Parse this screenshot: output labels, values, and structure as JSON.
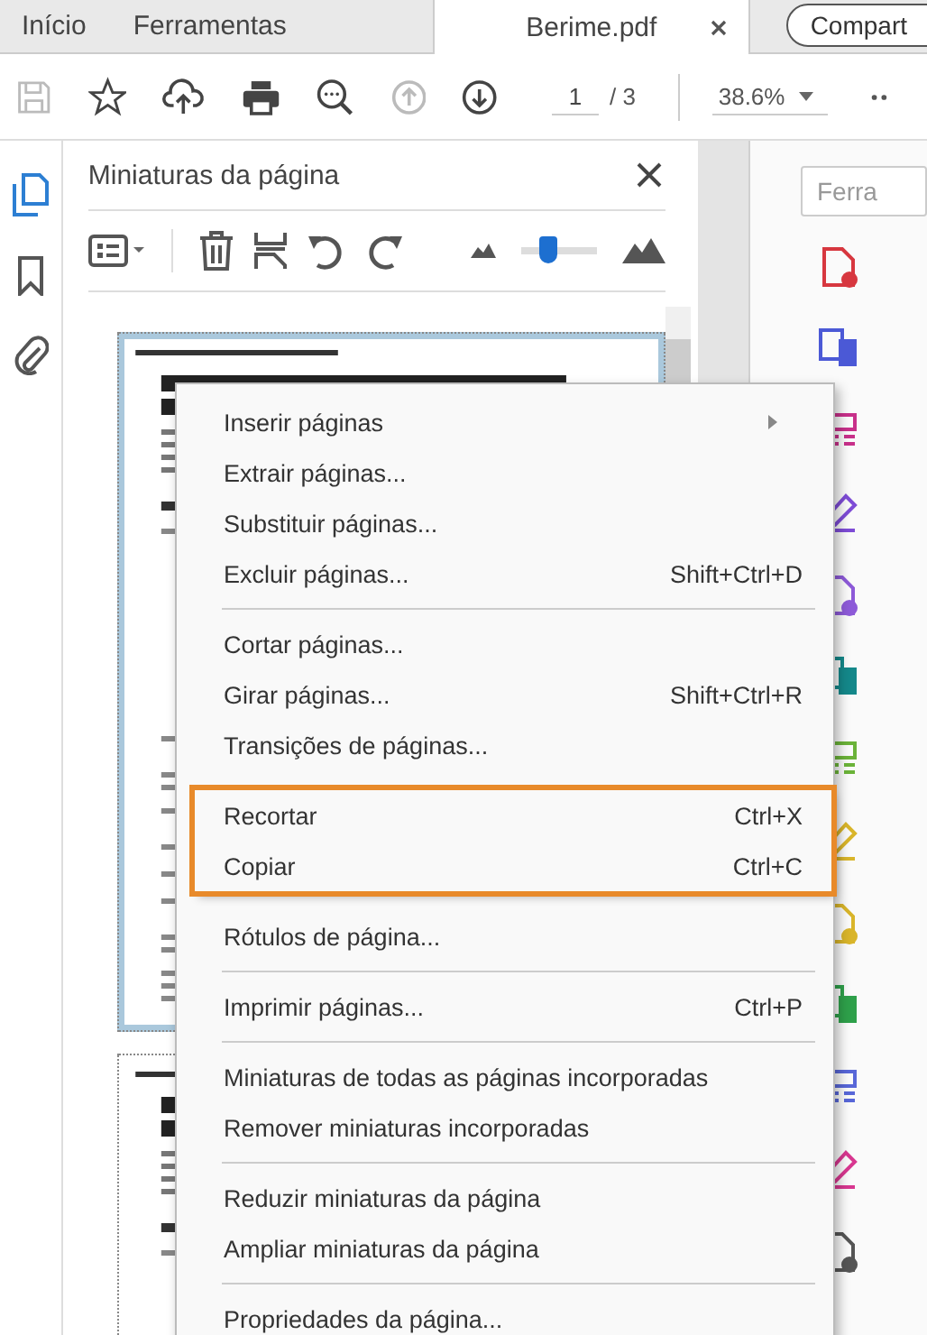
{
  "tabs": [
    {
      "label": "Início",
      "selected": false
    },
    {
      "label": "Ferramentas",
      "selected": false
    },
    {
      "label": "Berime.pdf",
      "selected": true,
      "closable": true
    }
  ],
  "share_button": {
    "label": "Compart"
  },
  "toolbar": {
    "page_current": "1",
    "page_total": "/ 3",
    "zoom": "38.6%"
  },
  "side_rail": [
    {
      "kind": "pages",
      "selected": true
    },
    {
      "kind": "bookmarks",
      "selected": false
    },
    {
      "kind": "attachments",
      "selected": false
    }
  ],
  "panel": {
    "title": "Miniaturas da página",
    "thumbnail_size": {
      "level": 0.37
    },
    "thumbnails": [
      {
        "selected": true
      },
      {
        "selected": false
      }
    ]
  },
  "tools_search": {
    "placeholder": "Ferra"
  },
  "context_menu": [
    {
      "highlighted": false,
      "items": [
        {
          "label": "Inserir páginas",
          "submenu": true
        },
        {
          "label": "Extrair páginas..."
        },
        {
          "label": "Substituir páginas..."
        },
        {
          "label": "Excluir páginas...",
          "shortcut": "Shift+Ctrl+D"
        }
      ]
    },
    {
      "highlighted": false,
      "items": [
        {
          "label": "Cortar páginas..."
        },
        {
          "label": "Girar páginas...",
          "shortcut": "Shift+Ctrl+R"
        },
        {
          "label": "Transições de páginas..."
        }
      ]
    },
    {
      "highlighted": true,
      "items": [
        {
          "label": "Recortar",
          "shortcut": "Ctrl+X"
        },
        {
          "label": "Copiar",
          "shortcut": "Ctrl+C"
        }
      ]
    },
    {
      "highlighted": false,
      "items": [
        {
          "label": "Rótulos de página..."
        }
      ]
    },
    {
      "highlighted": false,
      "items": [
        {
          "label": "Imprimir páginas...",
          "shortcut": "Ctrl+P"
        }
      ]
    },
    {
      "highlighted": false,
      "items": [
        {
          "label": "Miniaturas de todas as páginas incorporadas"
        },
        {
          "label": "Remover miniaturas incorporadas"
        }
      ]
    },
    {
      "highlighted": false,
      "items": [
        {
          "label": "Reduzir miniaturas da página"
        },
        {
          "label": "Ampliar miniaturas da página"
        }
      ]
    },
    {
      "highlighted": false,
      "items": [
        {
          "label": "Propriedades da página..."
        }
      ]
    }
  ]
}
